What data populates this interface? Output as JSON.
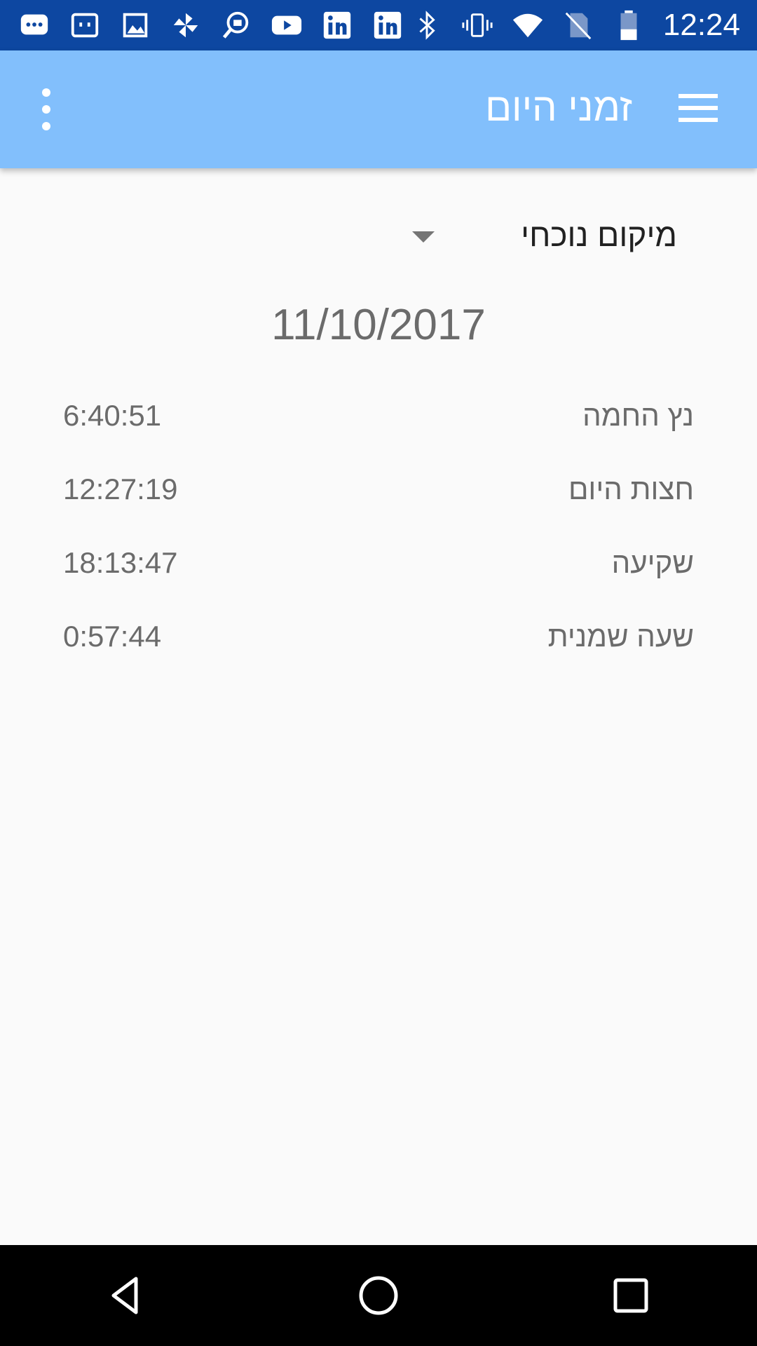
{
  "status_bar": {
    "time": "12:24",
    "left_icons": [
      "chat-icon",
      "message-icon",
      "gallery-icon",
      "pinwheel-icon",
      "job-search-icon",
      "youtube-icon",
      "linkedin-icon",
      "linkedin-icon"
    ],
    "right_icons": [
      "bluetooth-icon",
      "vibrate-icon",
      "wifi-icon",
      "no-sim-icon",
      "battery-icon"
    ],
    "background": "#0d47a1"
  },
  "app_bar": {
    "title": "זמני היום",
    "background": "#82bffc"
  },
  "location": {
    "selected": "מיקום נוכחי"
  },
  "date": "11/10/2017",
  "times": [
    {
      "name": "נץ החמה",
      "value": "6:40:51"
    },
    {
      "name": "חצות היום",
      "value": "12:27:19"
    },
    {
      "name": "שקיעה",
      "value": "18:13:47"
    },
    {
      "name": "שעה שמנית",
      "value": "0:57:44"
    }
  ]
}
